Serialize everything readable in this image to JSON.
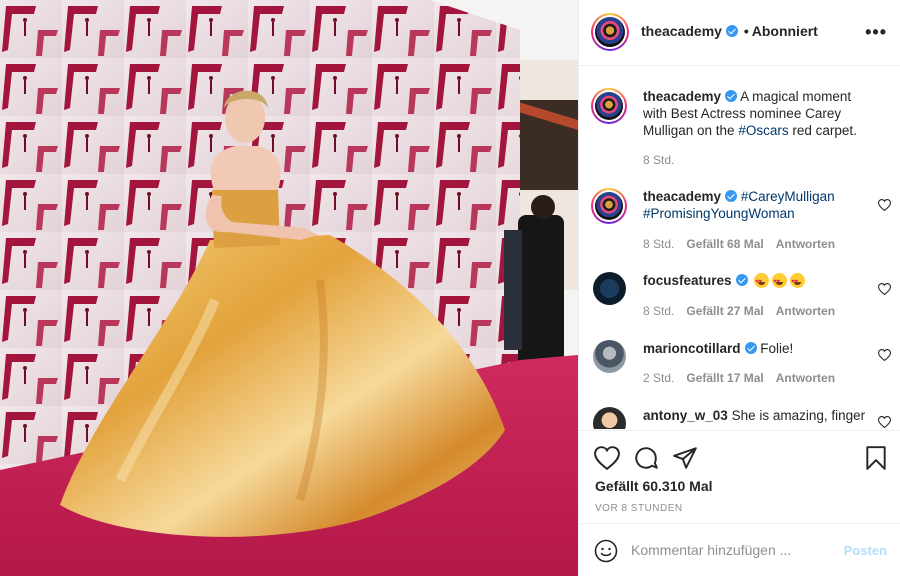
{
  "post": {
    "author": "theacademy",
    "follow_status": "Abonniert",
    "separator": "•",
    "more_icon": "more-horizontal-icon"
  },
  "caption": {
    "username": "theacademy",
    "text_before": "A magical moment with Best Actress nominee Carey Mulligan on the ",
    "hashtag": "#Oscars",
    "text_after": " red carpet.",
    "time": "8 Std."
  },
  "comments": [
    {
      "username": "theacademy",
      "verified": true,
      "hashtag1": "#CareyMulligan",
      "hashtag2": "#PromisingYoungWoman",
      "time": "8 Std.",
      "likes": "Gefällt 68 Mal",
      "reply": "Antworten"
    },
    {
      "username": "focusfeatures",
      "verified": true,
      "emoji": "heart-eyes-emoji x3",
      "time": "8 Std.",
      "likes": "Gefällt 27 Mal",
      "reply": "Antworten"
    },
    {
      "username": "marioncotillard",
      "verified": true,
      "text": "Folie!",
      "time": "2 Std.",
      "likes": "Gefällt 17 Mal",
      "reply": "Antworten"
    },
    {
      "username": "antony_w_03",
      "verified": false,
      "text": "She is amazing, finger"
    }
  ],
  "actions": {
    "likes": "Gefällt 60.310 Mal",
    "timestamp": "VOR 8 STUNDEN"
  },
  "compose": {
    "placeholder": "Kommentar hinzufügen ...",
    "post_label": "Posten"
  },
  "colors": {
    "link": "#00376b",
    "verified": "#3897f0",
    "muted": "#8e8e8e",
    "post_disabled": "#b2dffc",
    "carpet": "#c41e55",
    "gown": "#d9a033"
  }
}
